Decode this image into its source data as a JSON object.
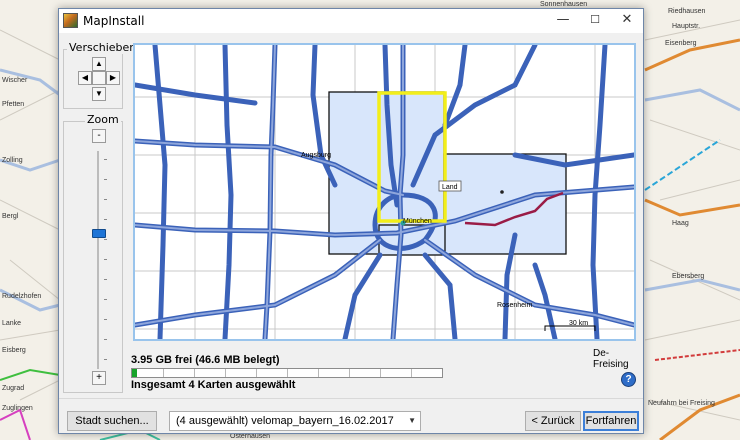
{
  "window": {
    "title": "MapInstall",
    "minimize_glyph": "—",
    "maximize_glyph": "☐",
    "close_glyph": "✕"
  },
  "pan": {
    "label": "Verschieben",
    "up_glyph": "▲",
    "down_glyph": "▼",
    "left_glyph": "◀",
    "right_glyph": "▶"
  },
  "zoom": {
    "label": "Zoom",
    "out_glyph": "-",
    "in_glyph": "+"
  },
  "map": {
    "labels": {
      "augsburg": "Augsburg",
      "muenchen": "München",
      "rosenheim": "Rosenheim",
      "tooltip": "Land",
      "scale": "30 km"
    },
    "colors": {
      "road": "#3b62b9",
      "road_fill": "#8ea6dc",
      "selected_tile_fill": "#d8e6fb",
      "highlight": "#f2ee1a",
      "river": "#9a1c46"
    }
  },
  "background": {
    "labels": {
      "l1": "Sonnenhausen",
      "l2": "Hauptstr.",
      "l3": "Wischer",
      "l4": "Eisenberg",
      "l5": "Riedhausen",
      "l6": "Pfetten",
      "l7": "Zolling",
      "l8": "Ebersberg",
      "l9": "Bergl",
      "l10": "Rudelzhofen",
      "l11": "Lanke",
      "l12": "Haag",
      "l13": "Eisberg",
      "l14": "Zugrad",
      "l15": "Zuglingen",
      "l16": "Osterhausen",
      "l17": "Neufahrn bei Freising"
    }
  },
  "status": {
    "free_space": "3.95 GB frei (46.6 MB belegt)",
    "region": "De-Freising",
    "selected_count": "Insgesamt 4 Karten ausgewählt",
    "progress_fraction": 0.015,
    "help_glyph": "?"
  },
  "footer": {
    "search_button": "Stadt suchen...",
    "map_select_value": "(4 ausgewählt) velomap_bayern_16.02.2017",
    "back_button": "< Zurück",
    "next_button": "Fortfahren"
  }
}
